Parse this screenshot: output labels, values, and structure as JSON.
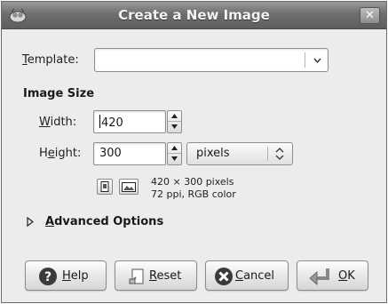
{
  "window": {
    "title": "Create a New Image",
    "close_glyph": "✕"
  },
  "template": {
    "label_mnemonic": "T",
    "label_rest": "emplate:",
    "value": "",
    "dropdown_icon": "chevron-down-icon"
  },
  "image_size": {
    "section_label": "Image Size",
    "width": {
      "label_mnemonic": "W",
      "label_rest": "idth:",
      "value": "420"
    },
    "height": {
      "label_pre": "H",
      "label_mnemonic": "e",
      "label_rest": "ight:",
      "value": "300"
    },
    "unit": "pixels",
    "info_line1": "420 × 300 pixels",
    "info_line2": "72 ppi, RGB color"
  },
  "advanced": {
    "label_mnemonic": "A",
    "label_rest": "dvanced Options",
    "expanded": false
  },
  "buttons": {
    "help": {
      "mnemonic": "H",
      "rest": "elp"
    },
    "reset": {
      "mnemonic": "R",
      "rest": "eset"
    },
    "cancel": {
      "mnemonic": "C",
      "rest": "ancel"
    },
    "ok": {
      "mnemonic": "O",
      "rest": "K"
    }
  },
  "colors": {
    "titlebar": "#6e6e6e",
    "dialog_bg": "#ececec"
  }
}
